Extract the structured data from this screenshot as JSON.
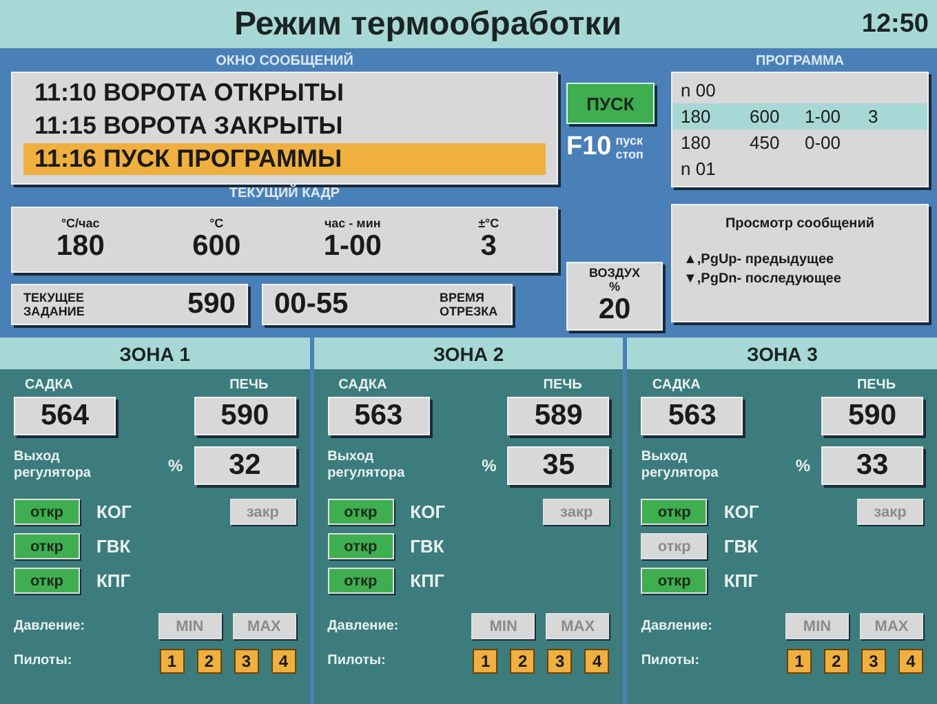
{
  "header": {
    "title": "Режим термообработки",
    "time": "12:50"
  },
  "messages": {
    "title": "ОКНО СООБЩЕНИЙ",
    "items": [
      {
        "text": "11:10 ВОРОТА ОТКРЫТЫ",
        "selected": false
      },
      {
        "text": "11:15 ВОРОТА ЗАКРЫТЫ",
        "selected": false
      },
      {
        "text": "11:16 ПУСК ПРОГРАММЫ",
        "selected": true
      }
    ]
  },
  "start": {
    "button": "ПУСК",
    "key": "F10",
    "hint_1": "пуск",
    "hint_2": "стоп"
  },
  "program": {
    "title": "ПРОГРАММА",
    "rows": [
      {
        "cells": [
          "n 00"
        ],
        "selected": false
      },
      {
        "cells": [
          "180",
          "600",
          "1-00",
          "3"
        ],
        "selected": true
      },
      {
        "cells": [
          "180",
          "450",
          "0-00"
        ],
        "selected": false
      },
      {
        "cells": [
          "n 01"
        ],
        "selected": false
      }
    ]
  },
  "frame": {
    "title": "ТЕКУЩИЙ КАДР",
    "fields": [
      {
        "label": "°С/час",
        "value": "180"
      },
      {
        "label": "°С",
        "value": "600"
      },
      {
        "label": "час - мин",
        "value": "1-00"
      },
      {
        "label": "±°С",
        "value": "3"
      }
    ]
  },
  "setpoint": {
    "label": "ТЕКУЩЕЕ ЗАДАНИЕ",
    "value": "590"
  },
  "segment_time": {
    "value": "00-55",
    "label": "ВРЕМЯ ОТРЕЗКА"
  },
  "air": {
    "label": "ВОЗДУХ",
    "unit": "%",
    "value": "20"
  },
  "message_view": {
    "title": "Просмотр сообщений",
    "lines": [
      "▲,PgUp- предыдущее",
      "▼,PgDn- последующее"
    ]
  },
  "zones": [
    {
      "title": "ЗОНА 1",
      "load_label": "САДКА",
      "load": "564",
      "furnace_label": "ПЕЧЬ",
      "furnace": "590",
      "output_label": "Выход регулятора",
      "unit": "%",
      "output": "32",
      "valves": [
        {
          "open": "откр",
          "active": true,
          "name": "КОГ",
          "close": "закр",
          "close_active": false
        },
        {
          "open": "откр",
          "active": true,
          "name": "ГВК"
        },
        {
          "open": "откр",
          "active": true,
          "name": "КПГ"
        }
      ],
      "pressure_label": "Давление:",
      "pressure": [
        {
          "text": "MIN",
          "active": false
        },
        {
          "text": "MAX",
          "active": false
        }
      ],
      "pilots_label": "Пилоты:",
      "pilots": [
        {
          "text": "1",
          "on": true
        },
        {
          "text": "2",
          "on": true
        },
        {
          "text": "3",
          "on": true
        },
        {
          "text": "4",
          "on": true
        }
      ]
    },
    {
      "title": "ЗОНА 2",
      "load_label": "САДКА",
      "load": "563",
      "furnace_label": "ПЕЧЬ",
      "furnace": "589",
      "output_label": "Выход регулятора",
      "unit": "%",
      "output": "35",
      "valves": [
        {
          "open": "откр",
          "active": true,
          "name": "КОГ",
          "close": "закр",
          "close_active": false
        },
        {
          "open": "откр",
          "active": true,
          "name": "ГВК"
        },
        {
          "open": "откр",
          "active": true,
          "name": "КПГ"
        }
      ],
      "pressure_label": "Давление:",
      "pressure": [
        {
          "text": "MIN",
          "active": false
        },
        {
          "text": "MAX",
          "active": false
        }
      ],
      "pilots_label": "Пилоты:",
      "pilots": [
        {
          "text": "1",
          "on": true
        },
        {
          "text": "2",
          "on": true
        },
        {
          "text": "3",
          "on": true
        },
        {
          "text": "4",
          "on": true
        }
      ]
    },
    {
      "title": "ЗОНА 3",
      "load_label": "САДКА",
      "load": "563",
      "furnace_label": "ПЕЧЬ",
      "furnace": "590",
      "output_label": "Выход регулятора",
      "unit": "%",
      "output": "33",
      "valves": [
        {
          "open": "откр",
          "active": true,
          "name": "КОГ",
          "close": "закр",
          "close_active": false
        },
        {
          "open": "откр",
          "active": false,
          "name": "ГВК"
        },
        {
          "open": "откр",
          "active": true,
          "name": "КПГ"
        }
      ],
      "pressure_label": "Давление:",
      "pressure": [
        {
          "text": "MIN",
          "active": false
        },
        {
          "text": "MAX",
          "active": false
        }
      ],
      "pilots_label": "Пилоты:",
      "pilots": [
        {
          "text": "1",
          "on": true
        },
        {
          "text": "2",
          "on": true
        },
        {
          "text": "3",
          "on": true
        },
        {
          "text": "4",
          "on": true
        }
      ]
    }
  ]
}
